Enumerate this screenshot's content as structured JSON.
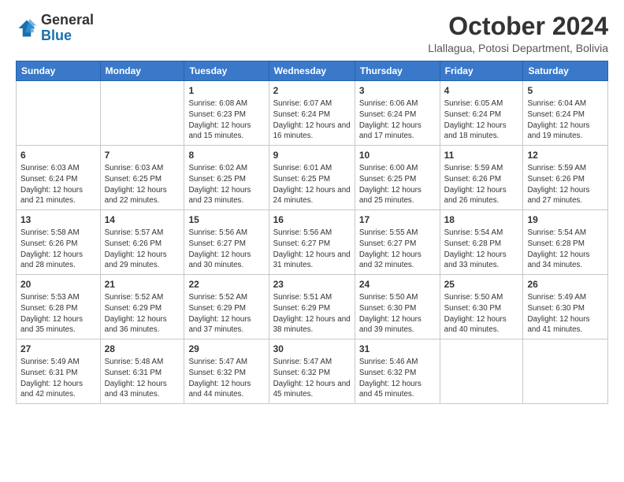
{
  "logo": {
    "general": "General",
    "blue": "Blue"
  },
  "header": {
    "month_year": "October 2024",
    "location": "Llallagua, Potosi Department, Bolivia"
  },
  "days_of_week": [
    "Sunday",
    "Monday",
    "Tuesday",
    "Wednesday",
    "Thursday",
    "Friday",
    "Saturday"
  ],
  "weeks": [
    [
      {
        "day": "",
        "info": ""
      },
      {
        "day": "",
        "info": ""
      },
      {
        "day": "1",
        "info": "Sunrise: 6:08 AM\nSunset: 6:23 PM\nDaylight: 12 hours and 15 minutes."
      },
      {
        "day": "2",
        "info": "Sunrise: 6:07 AM\nSunset: 6:24 PM\nDaylight: 12 hours and 16 minutes."
      },
      {
        "day": "3",
        "info": "Sunrise: 6:06 AM\nSunset: 6:24 PM\nDaylight: 12 hours and 17 minutes."
      },
      {
        "day": "4",
        "info": "Sunrise: 6:05 AM\nSunset: 6:24 PM\nDaylight: 12 hours and 18 minutes."
      },
      {
        "day": "5",
        "info": "Sunrise: 6:04 AM\nSunset: 6:24 PM\nDaylight: 12 hours and 19 minutes."
      }
    ],
    [
      {
        "day": "6",
        "info": "Sunrise: 6:03 AM\nSunset: 6:24 PM\nDaylight: 12 hours and 21 minutes."
      },
      {
        "day": "7",
        "info": "Sunrise: 6:03 AM\nSunset: 6:25 PM\nDaylight: 12 hours and 22 minutes."
      },
      {
        "day": "8",
        "info": "Sunrise: 6:02 AM\nSunset: 6:25 PM\nDaylight: 12 hours and 23 minutes."
      },
      {
        "day": "9",
        "info": "Sunrise: 6:01 AM\nSunset: 6:25 PM\nDaylight: 12 hours and 24 minutes."
      },
      {
        "day": "10",
        "info": "Sunrise: 6:00 AM\nSunset: 6:25 PM\nDaylight: 12 hours and 25 minutes."
      },
      {
        "day": "11",
        "info": "Sunrise: 5:59 AM\nSunset: 6:26 PM\nDaylight: 12 hours and 26 minutes."
      },
      {
        "day": "12",
        "info": "Sunrise: 5:59 AM\nSunset: 6:26 PM\nDaylight: 12 hours and 27 minutes."
      }
    ],
    [
      {
        "day": "13",
        "info": "Sunrise: 5:58 AM\nSunset: 6:26 PM\nDaylight: 12 hours and 28 minutes."
      },
      {
        "day": "14",
        "info": "Sunrise: 5:57 AM\nSunset: 6:26 PM\nDaylight: 12 hours and 29 minutes."
      },
      {
        "day": "15",
        "info": "Sunrise: 5:56 AM\nSunset: 6:27 PM\nDaylight: 12 hours and 30 minutes."
      },
      {
        "day": "16",
        "info": "Sunrise: 5:56 AM\nSunset: 6:27 PM\nDaylight: 12 hours and 31 minutes."
      },
      {
        "day": "17",
        "info": "Sunrise: 5:55 AM\nSunset: 6:27 PM\nDaylight: 12 hours and 32 minutes."
      },
      {
        "day": "18",
        "info": "Sunrise: 5:54 AM\nSunset: 6:28 PM\nDaylight: 12 hours and 33 minutes."
      },
      {
        "day": "19",
        "info": "Sunrise: 5:54 AM\nSunset: 6:28 PM\nDaylight: 12 hours and 34 minutes."
      }
    ],
    [
      {
        "day": "20",
        "info": "Sunrise: 5:53 AM\nSunset: 6:28 PM\nDaylight: 12 hours and 35 minutes."
      },
      {
        "day": "21",
        "info": "Sunrise: 5:52 AM\nSunset: 6:29 PM\nDaylight: 12 hours and 36 minutes."
      },
      {
        "day": "22",
        "info": "Sunrise: 5:52 AM\nSunset: 6:29 PM\nDaylight: 12 hours and 37 minutes."
      },
      {
        "day": "23",
        "info": "Sunrise: 5:51 AM\nSunset: 6:29 PM\nDaylight: 12 hours and 38 minutes."
      },
      {
        "day": "24",
        "info": "Sunrise: 5:50 AM\nSunset: 6:30 PM\nDaylight: 12 hours and 39 minutes."
      },
      {
        "day": "25",
        "info": "Sunrise: 5:50 AM\nSunset: 6:30 PM\nDaylight: 12 hours and 40 minutes."
      },
      {
        "day": "26",
        "info": "Sunrise: 5:49 AM\nSunset: 6:30 PM\nDaylight: 12 hours and 41 minutes."
      }
    ],
    [
      {
        "day": "27",
        "info": "Sunrise: 5:49 AM\nSunset: 6:31 PM\nDaylight: 12 hours and 42 minutes."
      },
      {
        "day": "28",
        "info": "Sunrise: 5:48 AM\nSunset: 6:31 PM\nDaylight: 12 hours and 43 minutes."
      },
      {
        "day": "29",
        "info": "Sunrise: 5:47 AM\nSunset: 6:32 PM\nDaylight: 12 hours and 44 minutes."
      },
      {
        "day": "30",
        "info": "Sunrise: 5:47 AM\nSunset: 6:32 PM\nDaylight: 12 hours and 45 minutes."
      },
      {
        "day": "31",
        "info": "Sunrise: 5:46 AM\nSunset: 6:32 PM\nDaylight: 12 hours and 45 minutes."
      },
      {
        "day": "",
        "info": ""
      },
      {
        "day": "",
        "info": ""
      }
    ]
  ]
}
